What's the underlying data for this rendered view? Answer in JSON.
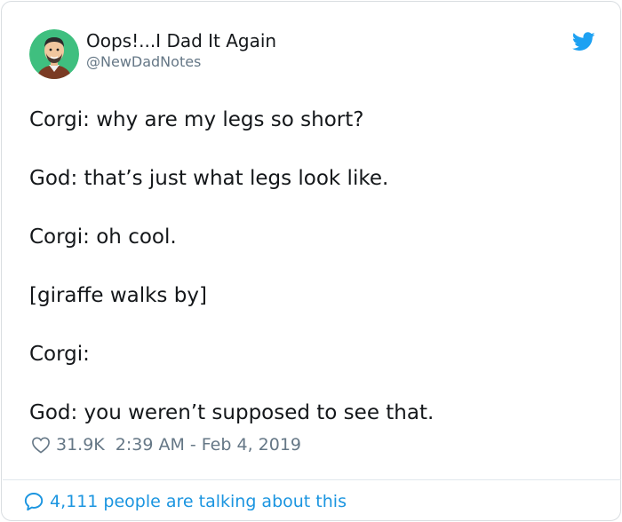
{
  "user": {
    "display_name": "Oops!...I Dad It Again",
    "handle": "@NewDadNotes"
  },
  "icons": {
    "avatar": "cartoon-man-avatar",
    "brand": "twitter-bird-icon",
    "like": "heart-outline-icon",
    "reply": "speech-bubble-icon"
  },
  "colors": {
    "brand_blue": "#1da1f2",
    "link_blue": "#1b95e0",
    "muted_text": "#657786",
    "body_text": "#14171a",
    "avatar_bg": "#3fbf7f"
  },
  "tweet": {
    "lines": [
      "Corgi: why are my legs so short?",
      "God: that’s just what legs look like.",
      "Corgi: oh cool.",
      "[giraffe walks by]",
      "Corgi:",
      "God: you weren’t supposed to see that."
    ]
  },
  "meta": {
    "likes": "31.9K",
    "timestamp": "2:39 AM - Feb 4, 2019"
  },
  "footer": {
    "talking": "4,111 people are talking about this"
  }
}
